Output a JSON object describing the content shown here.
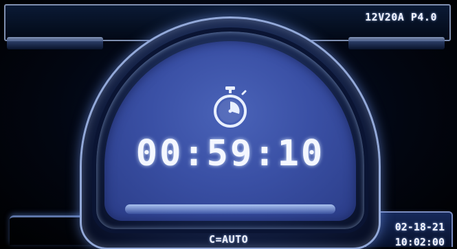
{
  "header": {
    "spec": "12V20A P4.0"
  },
  "timer": {
    "icon": "stopwatch-icon",
    "countdown": "00:59:10"
  },
  "footer": {
    "mode": "C=AUTO",
    "date": "02-18-21",
    "time": "10:02:00"
  },
  "colors": {
    "face": "#3a50a5",
    "text": "#f4f7ff",
    "frame": "#93a9d9"
  }
}
